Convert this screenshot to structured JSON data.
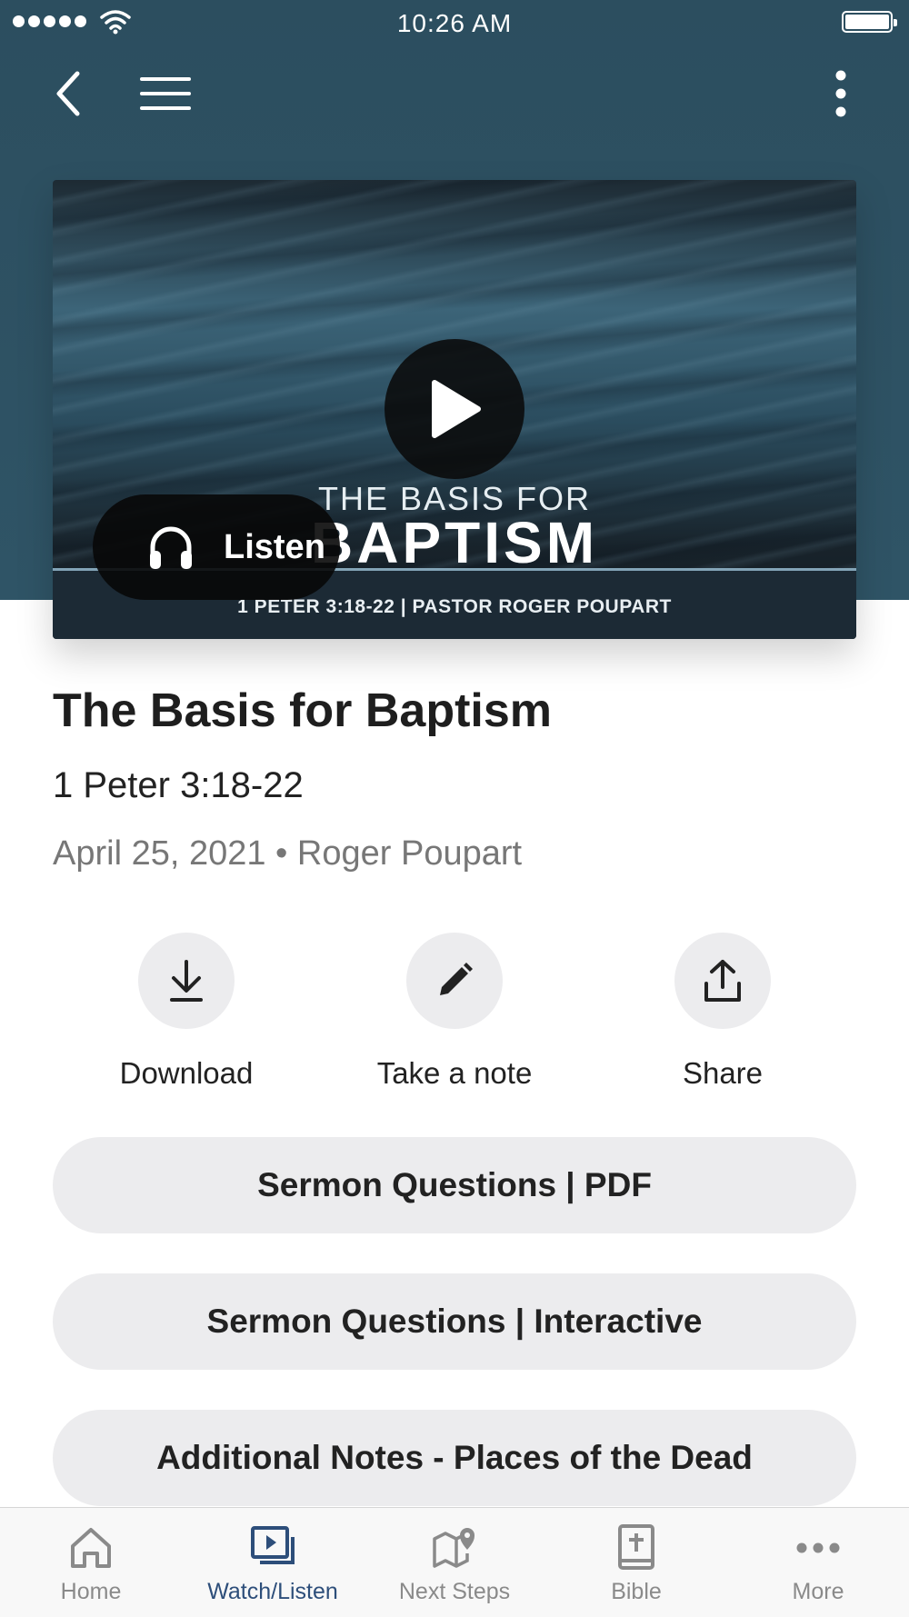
{
  "status_bar": {
    "time": "10:26 AM"
  },
  "hero": {
    "subtitle_line": "THE BASIS FOR",
    "title_line": "BAPTISM",
    "caption": "1 PETER 3:18-22 | PASTOR ROGER POUPART",
    "listen_label": "Listen"
  },
  "sermon": {
    "title": "The Basis for Baptism",
    "reference": "1 Peter 3:18-22",
    "meta": "April 25, 2021 • Roger Poupart"
  },
  "actions": [
    {
      "label": "Download",
      "icon": "download-icon"
    },
    {
      "label": "Take a note",
      "icon": "pencil-icon"
    },
    {
      "label": "Share",
      "icon": "share-icon"
    }
  ],
  "resources": [
    {
      "label": "Sermon Questions | PDF"
    },
    {
      "label": "Sermon Questions | Interactive"
    },
    {
      "label": "Additional Notes - Places of the Dead"
    }
  ],
  "tabs": [
    {
      "label": "Home",
      "icon": "home-icon",
      "active": false
    },
    {
      "label": "Watch/Listen",
      "icon": "video-library-icon",
      "active": true
    },
    {
      "label": "Next Steps",
      "icon": "map-pin-icon",
      "active": false
    },
    {
      "label": "Bible",
      "icon": "bible-icon",
      "active": false
    },
    {
      "label": "More",
      "icon": "more-horizontal-icon",
      "active": false
    }
  ],
  "colors": {
    "header": "#2f5466",
    "active_tab": "#2d4e7a",
    "inactive_tab": "#8a8a8a",
    "button_bg": "#ececee"
  }
}
